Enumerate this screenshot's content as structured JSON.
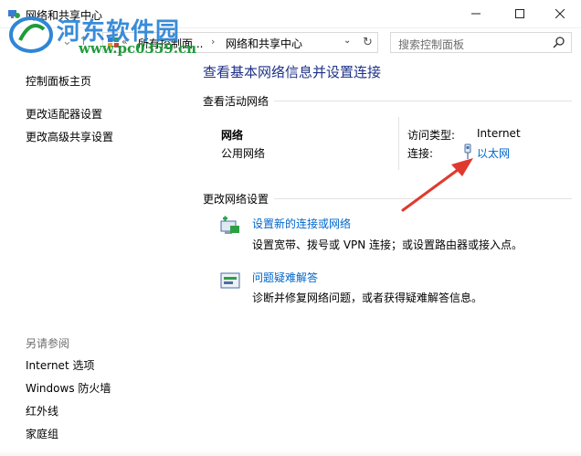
{
  "window": {
    "title": "网络和共享中心",
    "watermark": "河东软件园",
    "watermark_url": "www.pc0359.cn"
  },
  "nav": {
    "overflow": "«",
    "breadcrumbs": [
      "所有控制面...",
      "网络和共享中心"
    ],
    "search_placeholder": "搜索控制面板"
  },
  "sidebar": {
    "home": "控制面板主页",
    "links": [
      "更改适配器设置",
      "更改高级共享设置"
    ],
    "see_also_heading": "另请参阅",
    "see_also": [
      "Internet 选项",
      "Windows 防火墙",
      "红外线",
      "家庭组"
    ]
  },
  "main": {
    "title": "查看基本网络信息并设置连接",
    "active_section": "查看活动网络",
    "network_name": "网络",
    "network_type": "公用网络",
    "access_type_label": "访问类型:",
    "access_type_value": "Internet",
    "connection_label": "连接:",
    "connection_value": "以太网",
    "change_section": "更改网络设置",
    "tasks": [
      {
        "icon": "new-connection-icon",
        "link": "设置新的连接或网络",
        "desc": "设置宽带、拨号或 VPN 连接；或设置路由器或接入点。"
      },
      {
        "icon": "troubleshoot-icon",
        "link": "问题疑难解答",
        "desc": "诊断并修复网络问题，或者获得疑难解答信息。"
      }
    ]
  },
  "colors": {
    "title_blue": "#1e3287",
    "link_blue": "#0066cc",
    "arrow_red": "#e03a2f",
    "watermark_blue": "#2f86d6",
    "watermark_green": "#1e9b3a"
  }
}
